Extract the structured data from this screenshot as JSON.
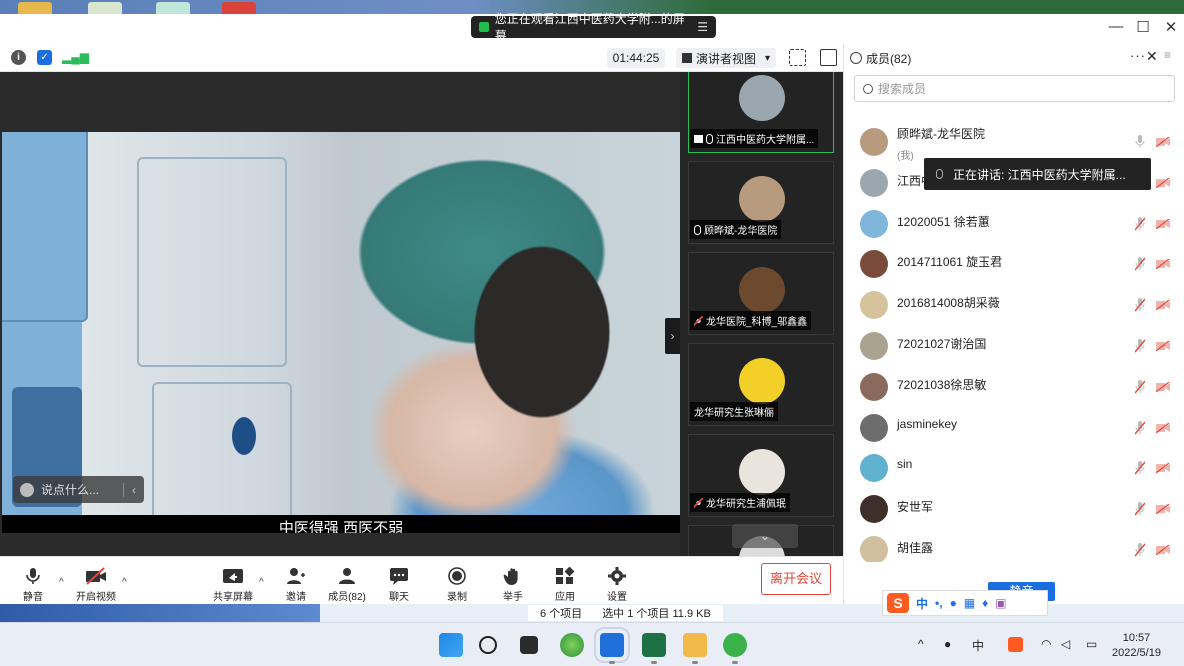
{
  "window": {
    "share_banner": "您正在观看江西中医药大学附...的屏幕",
    "share_menu_glyph": "☰",
    "controls": {
      "minimize": "—",
      "maximize": "☐",
      "close": "✕"
    }
  },
  "toolbar": {
    "timer": "01:44:25",
    "view_label": "演讲者视图",
    "view_caret": "▾"
  },
  "main_video": {
    "subtitle": "中医得强 西医不弱",
    "chat_placeholder": "说点什么...",
    "chat_collapse": "‹",
    "side_collapse": "›"
  },
  "thumbnails": [
    {
      "name": "江西中医药大学附属...",
      "mic": "on",
      "sharing": true,
      "active": true,
      "avatar_color": "#9aa7ae"
    },
    {
      "name": "顾晔斌-龙华医院",
      "mic": "on",
      "sharing": false,
      "active": false,
      "avatar_color": "#b89a7e"
    },
    {
      "name": "龙华医院_科博_邬鑫鑫",
      "mic": "muted",
      "sharing": false,
      "active": false,
      "avatar_color": "#6b4a2e"
    },
    {
      "name": "龙华研究生张琳俪",
      "mic": "none",
      "sharing": false,
      "active": false,
      "avatar_color": "#f2d027"
    },
    {
      "name": "龙华研究生浦佩珉",
      "mic": "muted",
      "sharing": false,
      "active": false,
      "avatar_color": "#e9e4dc"
    }
  ],
  "thumb_scroll_glyph": "⌄",
  "controls": {
    "mute": "静音",
    "video": "开启视频",
    "share": "共享屏幕",
    "invite": "邀请",
    "members": "成员(82)",
    "chat": "聊天",
    "record": "录制",
    "raise_hand": "举手",
    "apps": "应用",
    "settings": "设置",
    "leave": "离开会议",
    "caret": "^"
  },
  "members_panel": {
    "title": "成员(82)",
    "more": "···",
    "close": "✕",
    "menu": "≡",
    "search_placeholder": "搜索成员",
    "speaking_toast": "正在讲话: 江西中医药大学附属...",
    "mute_all": "静音",
    "members": [
      {
        "name": "顾晔斌-龙华医院",
        "sub": "(我)",
        "mic": "on-gray",
        "avatar_color": "#b89a7e"
      },
      {
        "name": "江西中医药大学附属",
        "sub": "",
        "mic": "on-gray",
        "avatar_color": "#9aa7ae"
      },
      {
        "name": "12020051 徐若蕙",
        "sub": "",
        "mic": "muted",
        "avatar_color": "#7fb6d9"
      },
      {
        "name": "2014711061 旋玉君",
        "sub": "",
        "mic": "muted",
        "avatar_color": "#7a4b3a"
      },
      {
        "name": "2016814008胡采薇",
        "sub": "",
        "mic": "muted",
        "avatar_color": "#d7c29e"
      },
      {
        "name": "72021027谢治国",
        "sub": "",
        "mic": "muted",
        "avatar_color": "#a9a48f"
      },
      {
        "name": "72021038徐思敏",
        "sub": "",
        "mic": "muted",
        "avatar_color": "#8a6a5c"
      },
      {
        "name": "jasminekey",
        "sub": "",
        "mic": "muted",
        "avatar_color": "#6d6d6d"
      },
      {
        "name": "sin",
        "sub": "",
        "mic": "muted",
        "avatar_color": "#5fb1cf"
      },
      {
        "name": "安世军",
        "sub": "",
        "mic": "muted",
        "avatar_color": "#3f2f2a"
      },
      {
        "name": "胡佳露",
        "sub": "",
        "mic": "muted",
        "avatar_color": "#d2bfa0"
      }
    ]
  },
  "ime": {
    "logo": "S",
    "lang": "中",
    "punct": "•,",
    "items": [
      "mic",
      "keyboard",
      "shirt",
      "grid"
    ]
  },
  "explorer_status": {
    "count": "6 个项目",
    "selected": "选中 1 个项目  11.9 KB"
  },
  "taskbar": {
    "tray_caret": "^",
    "tray_lang": "中",
    "time": "10:57",
    "date": "2022/5/19"
  },
  "colors": {
    "accent": "#1a6fe0",
    "danger": "#e2463a",
    "active_green": "#2bbd5b"
  }
}
